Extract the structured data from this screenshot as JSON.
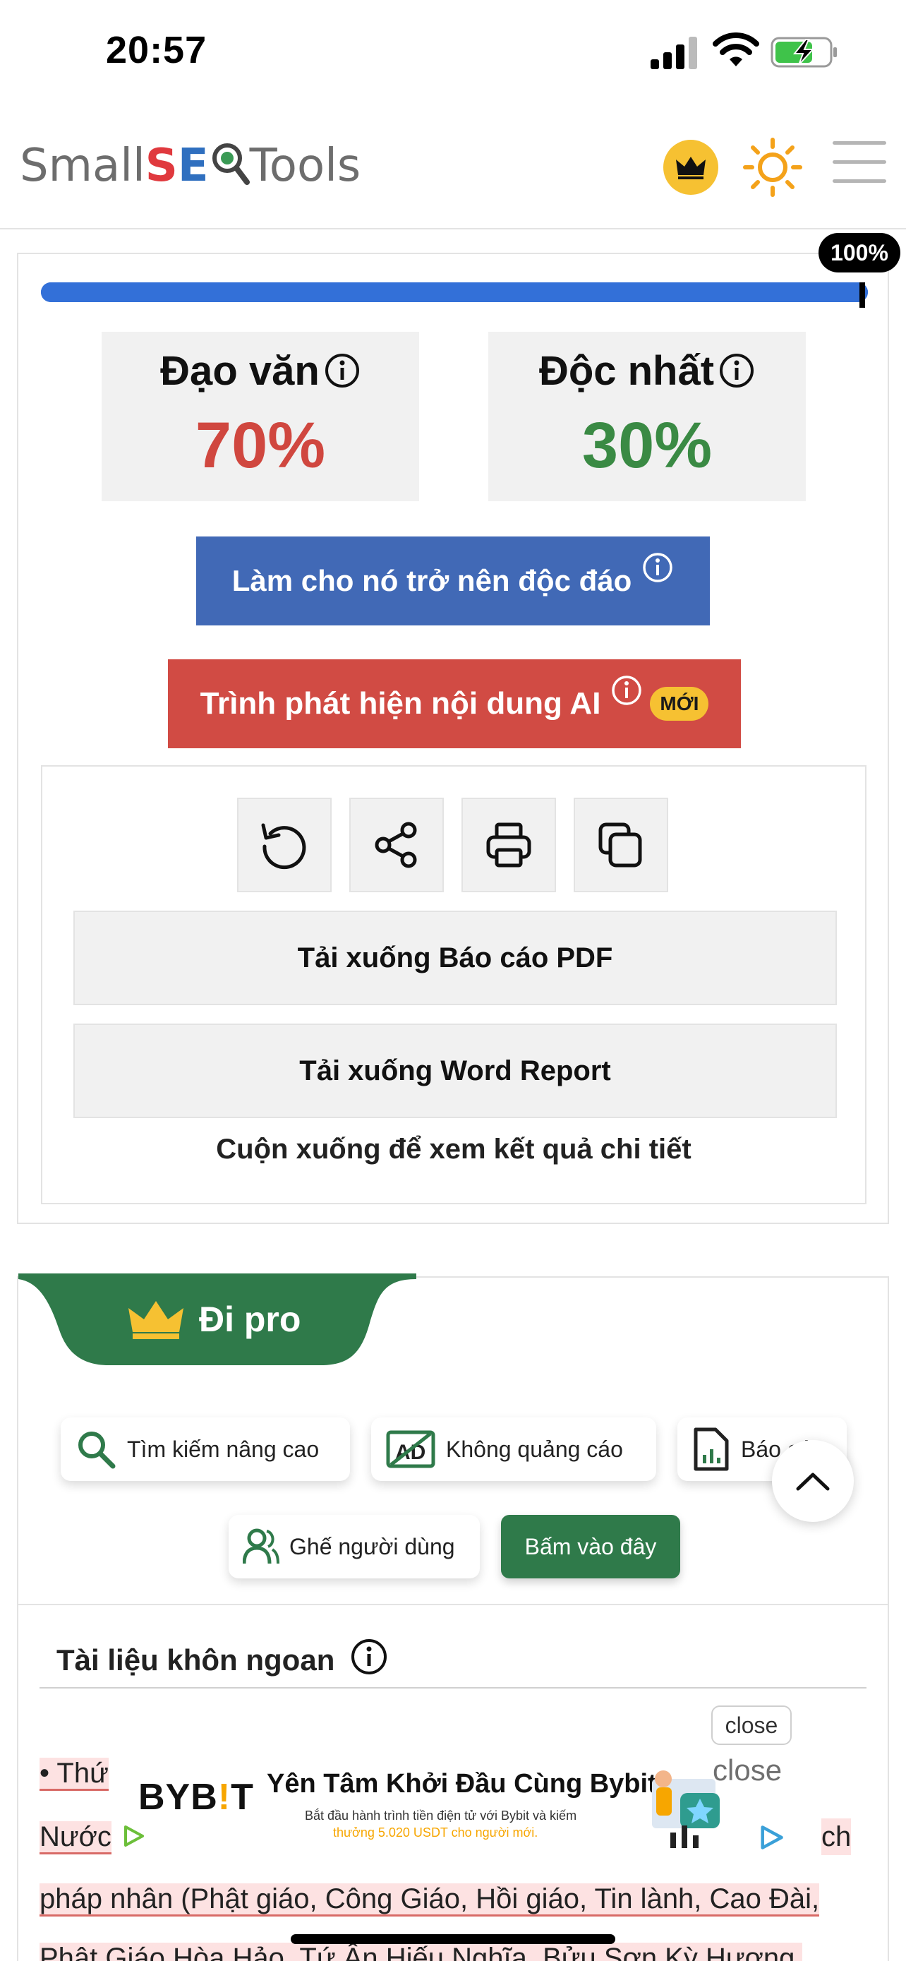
{
  "status_bar": {
    "time": "20:57"
  },
  "header": {
    "logo_small": "Small",
    "logo_s": "S",
    "logo_e": "E",
    "logo_tools": "Tools"
  },
  "progress": {
    "percent_label": "100%",
    "value": 1.0
  },
  "scores": {
    "plagiarism_label": "Đạo văn",
    "plagiarism_value": "70%",
    "unique_label": "Độc nhất",
    "unique_value": "30%"
  },
  "buttons": {
    "make_unique": "Làm cho nó trở nên độc đáo",
    "ai_detector": "Trình phát hiện nội dung AI",
    "new_badge": "MỚI",
    "download_pdf": "Tải xuống Báo cáo PDF",
    "download_word": "Tải xuống Word Report",
    "scroll_note": "Cuộn xuống để xem kết quả chi tiết"
  },
  "pro": {
    "title": "Đi pro",
    "features": [
      {
        "label": "Tìm kiếm nâng cao",
        "icon": "search-icon"
      },
      {
        "label": "Không quảng cáo",
        "icon": "no-ads-icon"
      },
      {
        "label": "Báo cáo",
        "icon": "report-icon"
      },
      {
        "label": "Ghế người dùng",
        "icon": "users-icon"
      }
    ],
    "cta": "Bấm vào đây"
  },
  "document": {
    "title": "Tài liệu khôn ngoan",
    "line1_prefix": "• Thứ",
    "line2_prefix": "Nước",
    "line2_suffix": "ch",
    "line3": "pháp nhân (Phật giáo, Công Giáo, Hồi giáo, Tin lành, Cao Đài,",
    "line4": "Phật Giáo Hòa Hảo, Tứ Ân Hiếu Nghĩa, Bửu Sơn Kỳ Hương,"
  },
  "ad": {
    "brand_part1": "BYB",
    "brand_accent": "!",
    "brand_part2": "T",
    "headline": "Yên Tâm Khởi Đầu Cùng Bybit",
    "sub1": "Bắt đầu hành trình tiền điện tử với Bybit và kiếm",
    "sub2": "thưởng 5.020 USDT cho người mới.",
    "close_button": "close",
    "close_text": "close"
  },
  "colors": {
    "progress": "#3370d8",
    "plagiarism": "#d0473f",
    "unique": "#3a8a44",
    "unique_btn": "#4169b6",
    "ai_btn": "#d14b44",
    "pro_green": "#2f7a4a",
    "crown_yellow": "#f6c132"
  }
}
